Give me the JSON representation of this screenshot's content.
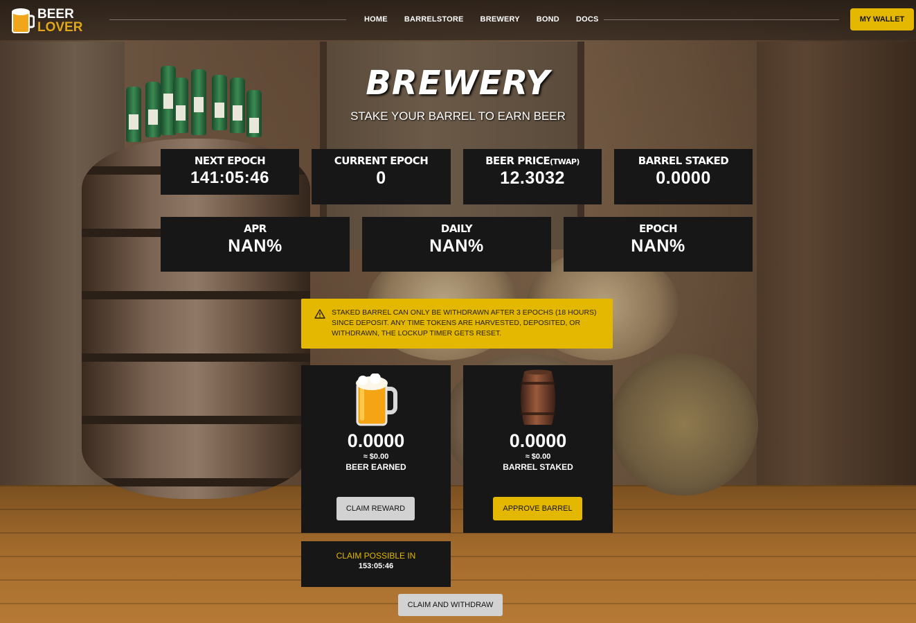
{
  "brand": {
    "line1": "BEER",
    "line2": "LOVER"
  },
  "nav": {
    "items": [
      "HOME",
      "BARRELSTORE",
      "BREWERY",
      "BOND",
      "DOCS"
    ],
    "wallet_label": "MY WALLET"
  },
  "page": {
    "title": "BREWERY",
    "subtitle": "STAKE YOUR BARREL TO EARN BEER"
  },
  "stats_row1": [
    {
      "label": "NEXT EPOCH",
      "value": "141:05:46"
    },
    {
      "label": "CURRENT EPOCH",
      "value": "0"
    },
    {
      "label": "BEER PRICE",
      "label_suffix": "(TWAP)",
      "value": "12.3032"
    },
    {
      "label": "BARREL STAKED",
      "value": "0.0000"
    }
  ],
  "stats_row2": [
    {
      "label": "APR",
      "value": "NAN%"
    },
    {
      "label": "DAILY",
      "value": "NAN%"
    },
    {
      "label": "EPOCH",
      "value": "NAN%"
    }
  ],
  "warning": {
    "icon": "warning-triangle-icon",
    "text": "STAKED BARREL CAN ONLY BE WITHDRAWN AFTER 3 EPOCHS (18 HOURS) SINCE DEPOSIT. ANY TIME TOKENS ARE HARVESTED, DEPOSITED, OR WITHDRAWN, THE LOCKUP TIMER GETS RESET."
  },
  "earned_panel": {
    "icon": "beer-mug-icon",
    "amount": "0.0000",
    "usd": "≈ $0.00",
    "label": "BEER EARNED",
    "button": "CLAIM REWARD"
  },
  "staked_panel": {
    "icon": "barrel-icon",
    "amount": "0.0000",
    "usd": "≈ $0.00",
    "label": "BARREL STAKED",
    "button": "APPROVE BARREL"
  },
  "claim": {
    "label": "CLAIM POSSIBLE IN",
    "time": "153:05:46",
    "withdraw_button": "CLAIM AND WITHDRAW"
  },
  "colors": {
    "accent": "#e4b800",
    "card": "#171717",
    "button_grey": "#d2d2d2"
  }
}
